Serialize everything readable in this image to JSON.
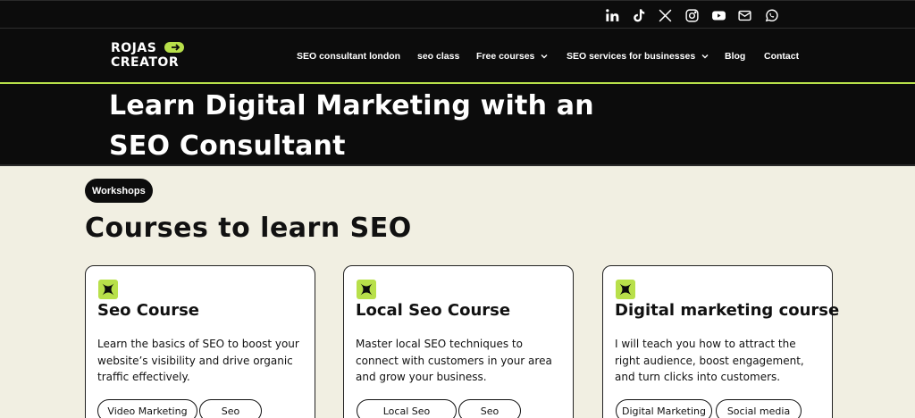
{
  "colors": {
    "accent": "#b8e04a",
    "dark": "#0c0c0c",
    "background": "#f1efe2"
  },
  "social": [
    "linkedin-icon",
    "tiktok-icon",
    "x-icon",
    "instagram-icon",
    "youtube-icon",
    "mail-icon",
    "whatsapp-icon"
  ],
  "logo": {
    "line1": "ROJAS",
    "line2": "CREATOR"
  },
  "nav": {
    "items": [
      {
        "label": "SEO consultant london"
      },
      {
        "label": "seo class"
      },
      {
        "label": "Free courses"
      },
      {
        "label": "SEO services for businesses"
      },
      {
        "label": "Blog"
      },
      {
        "label": "Contact"
      }
    ]
  },
  "hero": {
    "title": "Learn Digital Marketing with an SEO Consultant"
  },
  "section": {
    "badge": "Workshops",
    "title": "Courses to learn SEO"
  },
  "cards": [
    {
      "title": "Seo Course",
      "description": "Learn the basics of SEO to boost your website’s visibility and drive organic traffic effectively.",
      "tags": [
        "Video Marketing",
        "Seo"
      ]
    },
    {
      "title": "Local Seo Course",
      "description": "Master local SEO techniques to connect with customers in your area and grow your business.",
      "tags": [
        "Local Seo",
        "Seo"
      ]
    },
    {
      "title": "Digital marketing course",
      "description": "I will teach you how to attract the right audience, boost engagement, and turn clicks into customers.",
      "tags": [
        "Digital Marketing",
        "Social media"
      ]
    }
  ]
}
